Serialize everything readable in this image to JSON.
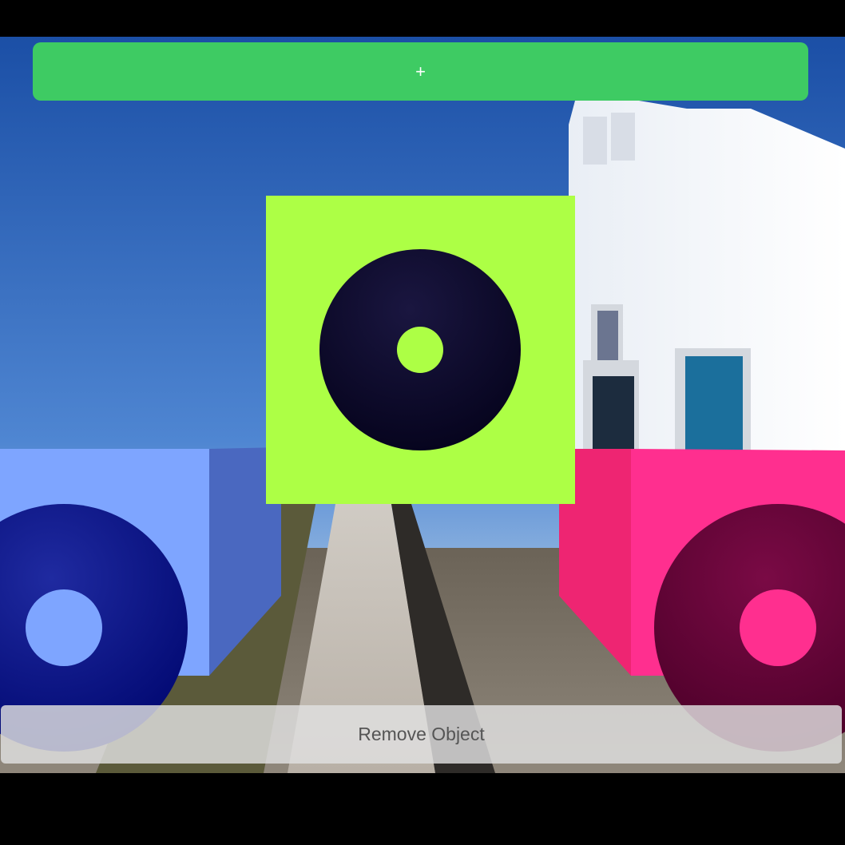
{
  "toolbar": {
    "add_label": "+",
    "remove_label": "Remove Object"
  },
  "scene": {
    "objects": [
      {
        "name": "blue-cube",
        "face_color": "#7ea5ff",
        "side_color": "#4a68c0",
        "torus_color": "#000a80"
      },
      {
        "name": "green-cube",
        "face_color": "#adff45",
        "torus_color": "#06041f"
      },
      {
        "name": "pink-cube",
        "face_color": "#ff2f8f",
        "side_color": "#ee2572",
        "torus_color": "#5a0030"
      }
    ],
    "add_button_color": "#3ecb63"
  }
}
